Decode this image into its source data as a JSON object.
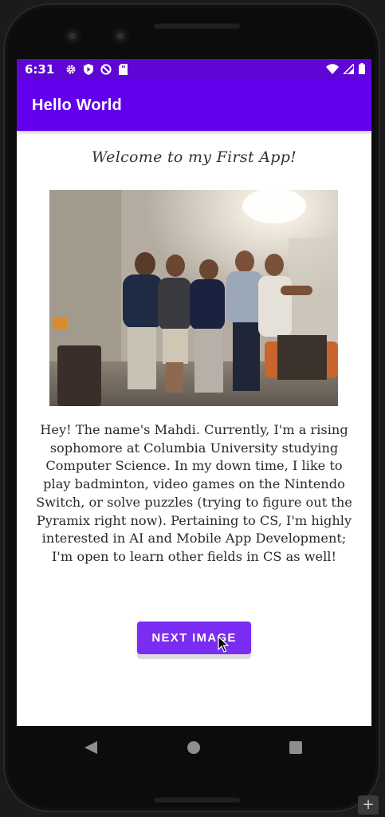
{
  "status_bar": {
    "time": "6:31",
    "left_icons": [
      "gear-icon",
      "shield-icon",
      "no-disturb-icon",
      "sd-card-icon"
    ],
    "right_icons": [
      "wifi-icon",
      "signal-icon",
      "battery-icon"
    ],
    "color": "#5e06d6"
  },
  "app_bar": {
    "title": "Hello World",
    "color": "#6200ee"
  },
  "main": {
    "welcome": "Welcome to my First App!",
    "photo_alt": "group-photo",
    "bio": "Hey! The name's Mahdi. Currently, I'm a rising sophomore at Columbia University studying Computer Science. In my down time, I like to play badminton, video games on the Nintendo Switch, or solve puzzles (trying to figure out the Pyramix right now). Pertaining to CS, I'm highly interested in AI and Mobile App Development; I'm open to learn other fields in CS as well!",
    "next_button": "NEXT IMAGE",
    "button_color": "#7b2cf2"
  },
  "nav": {
    "back_icon": "back-triangle-icon",
    "home_icon": "home-circle-icon",
    "recents_icon": "recents-square-icon"
  },
  "emulator": {
    "plus_label": "+"
  }
}
